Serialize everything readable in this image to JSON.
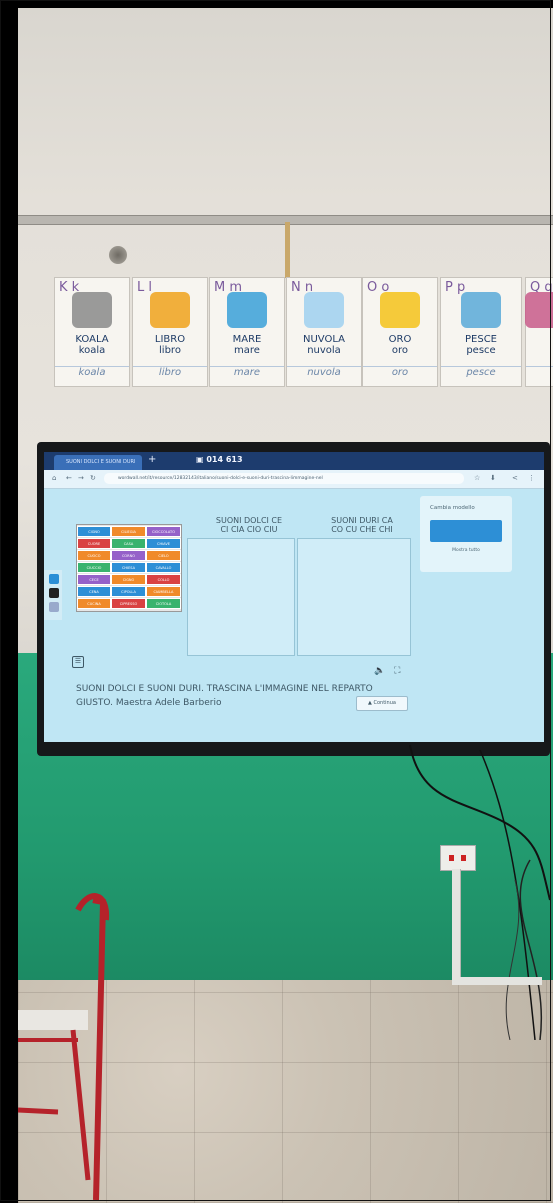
{
  "wall_cards": [
    {
      "letters": "K k",
      "word_caps": "KOALA",
      "word_lower": "koala",
      "word_cursive": "koala",
      "accent": "#8a8a8a"
    },
    {
      "letters": "L l",
      "word_caps": "LIBRO",
      "word_lower": "libro",
      "word_cursive": "libro",
      "accent": "#f0a21c"
    },
    {
      "letters": "M m",
      "word_caps": "MARE",
      "word_lower": "mare",
      "word_cursive": "mare",
      "accent": "#3aa0d8"
    },
    {
      "letters": "N n",
      "word_caps": "NUVOLA",
      "word_lower": "nuvola",
      "word_cursive": "nuvola",
      "accent": "#9fd0f0"
    },
    {
      "letters": "O o",
      "word_caps": "ORO",
      "word_lower": "oro",
      "word_cursive": "oro",
      "accent": "#f4c21a"
    },
    {
      "letters": "P p",
      "word_caps": "PESCE",
      "word_lower": "pesce",
      "word_cursive": "pesce",
      "accent": "#59a9d8"
    },
    {
      "letters": "Q q",
      "word_caps": "",
      "word_lower": "",
      "word_cursive": "",
      "accent": "#c85a8a"
    }
  ],
  "browser": {
    "tab_title": "SUONI DOLCI E SUONI DURI",
    "new_tab": "+",
    "session_code": "014 613",
    "url": "wordwall.net/it/resource/12832143/italiano/suoni-dolci-e-suoni-duri-trascina-limmagine-nel"
  },
  "activity": {
    "soft_header": "SUONI DOLCI CE\nCI CIA CIO CIU",
    "hard_header": "SUONI DURI CA\nCO CU CHE CHI",
    "caption": "SUONI DOLCI E SUONI DURI. TRASCINA L'IMMAGINE NEL REPARTO GIUSTO. Maestra Adele Barberio",
    "continue_label": "Continua",
    "template_panel_title": "Cambia modello",
    "template_panel_link": "Mostra tutto"
  },
  "tile_words": [
    "CIGNO",
    "CILIEGIA",
    "CIOCCOLATO",
    "CUORE",
    "CASA",
    "CHIAVE",
    "CUOCO",
    "CORNO",
    "CIELO",
    "CIUCCIO",
    "CHIESA",
    "CAVALLO",
    "CECE",
    "CIGNO",
    "COLLO",
    "CENA",
    "CIPOLLA",
    "CIAMBELLA",
    "CUCINA",
    "CIPRESSO",
    "CIOTOLA"
  ],
  "colors": {
    "wall": "#e4e0d9",
    "green_wall": "#229a6f",
    "screen_bg": "#bfe6f4",
    "tab_bar": "#1d3c6e",
    "tile_blue": "#2d8fd6",
    "tile_green": "#39b36e",
    "tile_orange": "#f08a2a",
    "tile_red": "#d94242",
    "tile_purple": "#9561c9"
  }
}
